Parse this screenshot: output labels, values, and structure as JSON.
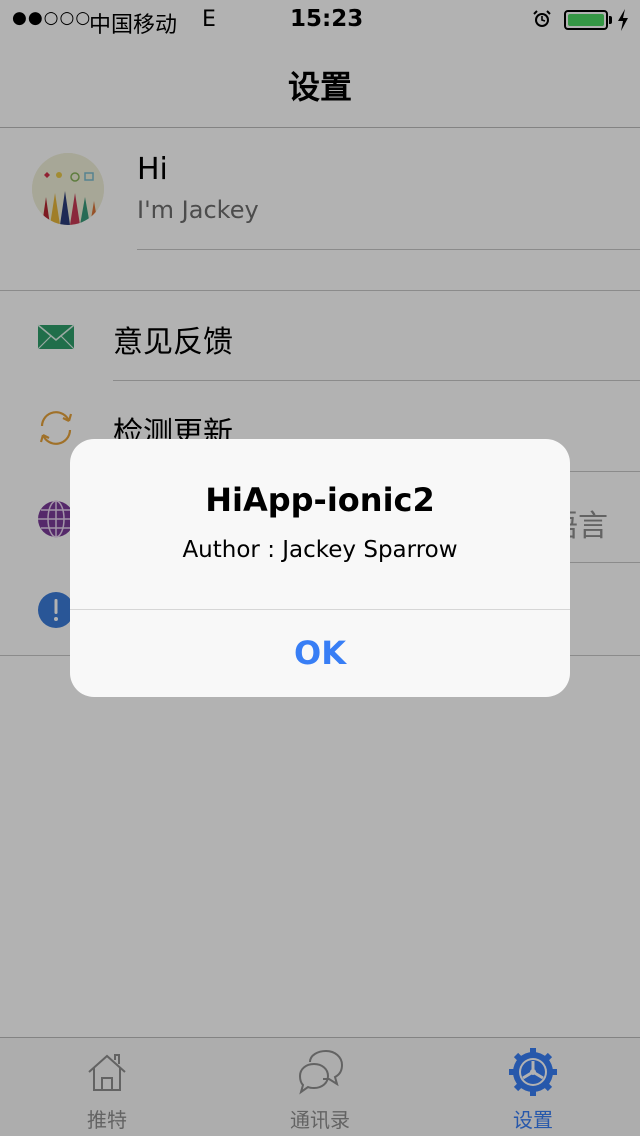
{
  "status_bar": {
    "signal": "●●○○○",
    "carrier": "中国移动",
    "network": "E",
    "time": "15:23"
  },
  "nav": {
    "title": "设置"
  },
  "profile": {
    "name": "Hi",
    "subtitle": "I'm Jackey"
  },
  "menu": {
    "items": [
      {
        "label": "意见反馈",
        "icon": "mail-icon"
      },
      {
        "label": "检测更新",
        "icon": "refresh-icon"
      },
      {
        "label": "",
        "value": "语言",
        "icon": "globe-icon"
      },
      {
        "label": "",
        "icon": "info-icon"
      }
    ]
  },
  "tabs": [
    {
      "label": "推特",
      "icon": "home-icon",
      "active": false
    },
    {
      "label": "通讯录",
      "icon": "chat-icon",
      "active": false
    },
    {
      "label": "设置",
      "icon": "settings-icon",
      "active": true
    }
  ],
  "alert": {
    "title": "HiApp-ionic2",
    "message": "Author : Jackey Sparrow",
    "button": "OK"
  },
  "colors": {
    "accent": "#387ef5",
    "battery": "#4cd964",
    "mail": "#2f9e6a",
    "refresh": "#e6a23c",
    "globe": "#7a3b98",
    "info": "#3b7bd8"
  }
}
